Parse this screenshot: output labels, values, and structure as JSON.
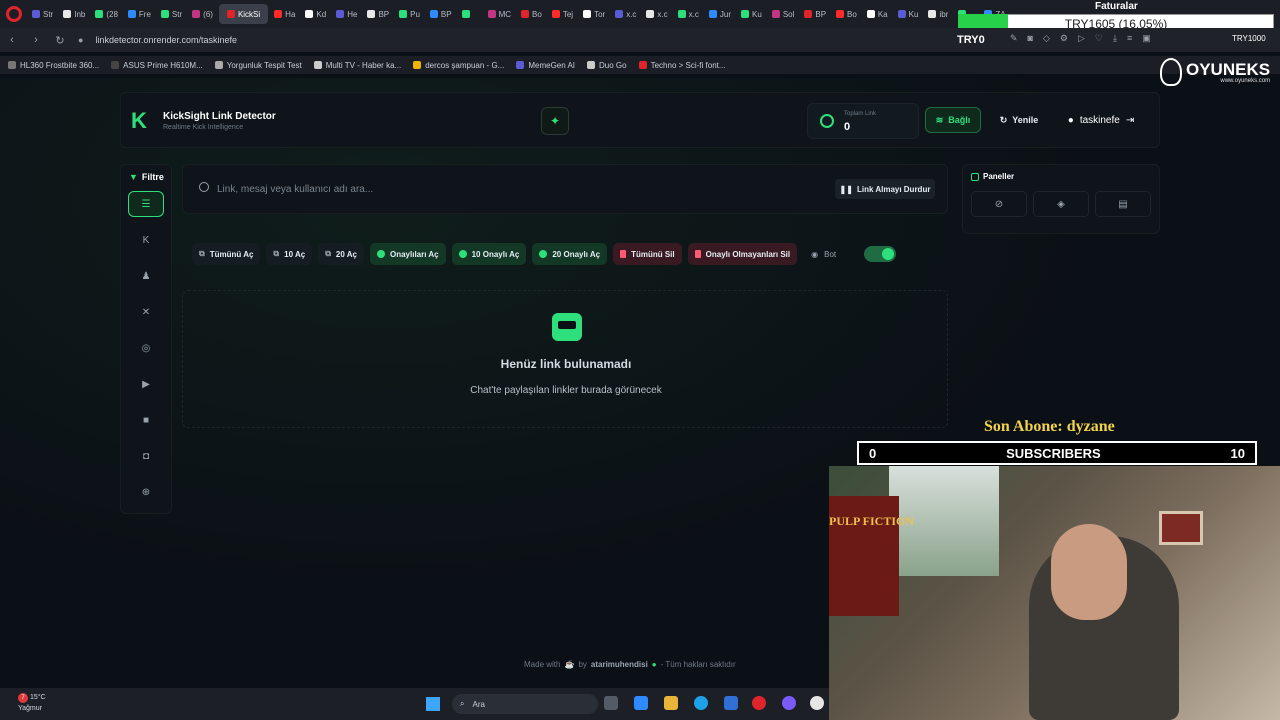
{
  "browser": {
    "tabs": [
      "Str",
      "Inb",
      "(28",
      "Fre",
      "Str",
      "(6)",
      "KickSi",
      "Ha",
      "Kd",
      "He",
      "BP",
      "Pu",
      "BP",
      "",
      "MC",
      "Bo",
      "Tej",
      "Tor",
      "x.c",
      "x.c",
      "x.c",
      "Jur",
      "Ku",
      "Sol",
      "BP",
      "Bo",
      "Ka",
      "Ku",
      "ibr",
      "",
      "ZA"
    ],
    "url": "linkdetector.onrender.com/taskinefe",
    "bookmarks": [
      "HL360 Frostbite 360...",
      "ASUS Prime H610M...",
      "Yorgunluk Tespit Test",
      "Multi TV - Haber ka...",
      "dercos şampuan - G...",
      "MemeGen AI",
      "Duo Go",
      "Techno > Sci-fi font..."
    ],
    "overlay_text": "TRY1605 (16.05%)",
    "faturalar": "Faturalar",
    "try0": "TRY0",
    "try1000": "TRY1000"
  },
  "ad_logo": {
    "title": "OYUNEKS",
    "sub": "www.oyuneks.com"
  },
  "header": {
    "brand_title": "KickSight Link Detector",
    "brand_sub": "Realtime Kick Intelligence",
    "stat_label": "Toplam Link",
    "stat_value": "0",
    "connected_label": "Bağlı",
    "refresh_label": "Yenile",
    "username": "taskinefe"
  },
  "filter": {
    "title": "Filtre"
  },
  "search": {
    "placeholder": "Link, mesaj veya kullanıcı adı ara...",
    "pause_label": "Link Almayı Durdur"
  },
  "actions": [
    {
      "label": "Tümünü Aç",
      "style": "plain"
    },
    {
      "label": "10 Aç",
      "style": "plain"
    },
    {
      "label": "20 Aç",
      "style": "plain"
    },
    {
      "label": "Onaylıları Aç",
      "style": "green"
    },
    {
      "label": "10 Onaylı Aç",
      "style": "green"
    },
    {
      "label": "20 Onaylı Aç",
      "style": "green"
    },
    {
      "label": "Tümünü Sil",
      "style": "red"
    },
    {
      "label": "Onaylı Olmayanları Sil",
      "style": "red"
    }
  ],
  "bot": {
    "label": "Bot",
    "enabled": true
  },
  "empty": {
    "title": "Henüz link bulunamadı",
    "subtitle": "Chat'te paylaşılan linkler burada görünecek"
  },
  "panels": {
    "title": "Paneller"
  },
  "footer": {
    "made_with": "Made with",
    "by": "by",
    "author": "atarimuhendisi",
    "rights": "- Tüm hakları saklıdır"
  },
  "stream": {
    "last_sub": "Son Abone: dyzane",
    "sub_start": "0",
    "sub_label": "SUBSCRIBERS",
    "sub_goal": "10",
    "poster": "PULP FICTION"
  },
  "taskbar": {
    "temp": "15°C",
    "weather": "Yağmur",
    "badge": "7",
    "search": "Ara"
  },
  "colors": {
    "accent": "#2ee07b",
    "danger": "#ff5b77",
    "bg": "#0b0f16"
  }
}
